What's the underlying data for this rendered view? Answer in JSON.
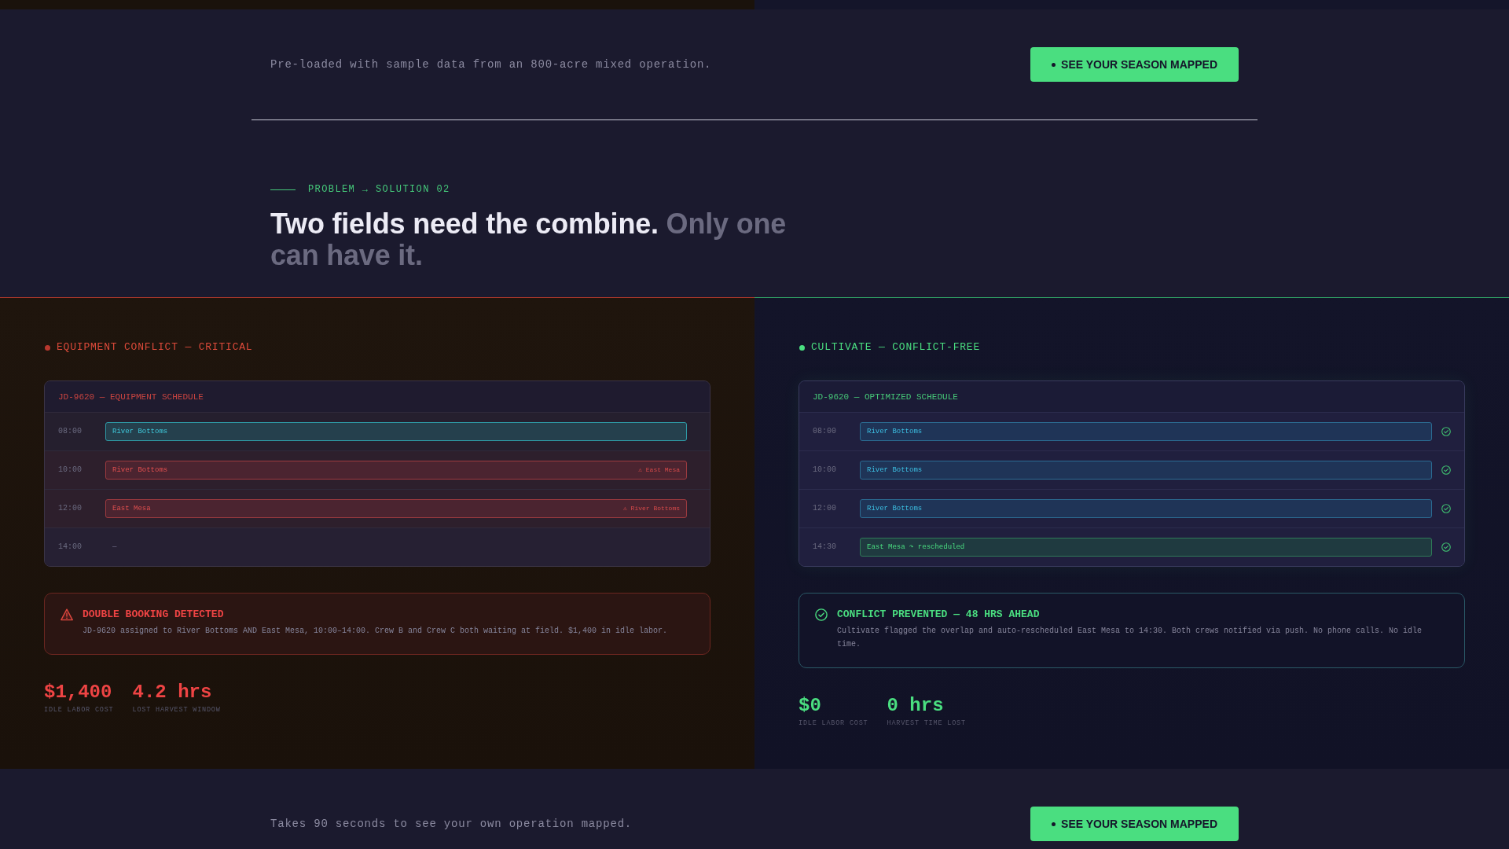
{
  "top_cta": {
    "text": "Pre-loaded with sample data from an 800-acre mixed operation.",
    "button": "SEE YOUR SEASON MAPPED"
  },
  "section": {
    "eyebrow": "PROBLEM → SOLUTION 02",
    "heading": "Two fields need the combine.",
    "heading_muted": "Only one can have it."
  },
  "panels": [
    {
      "kind": "problem",
      "color": "#b8382e",
      "label": "EQUIPMENT CONFLICT — CRITICAL",
      "schedule": {
        "title": "JD-9620 — EQUIPMENT SCHEDULE",
        "rows": [
          {
            "time": "08:00",
            "kind": "booked",
            "field": "River Bottoms",
            "confirmed": false
          },
          {
            "time": "10:00",
            "kind": "conflict",
            "field": "River Bottoms",
            "note": "⚠ East Mesa",
            "confirmed": false
          },
          {
            "time": "12:00",
            "kind": "conflict",
            "field": "East Mesa",
            "note": "⚠ River Bottoms",
            "confirmed": false
          },
          {
            "time": "14:00",
            "kind": "empty",
            "field": "—",
            "confirmed": false
          }
        ]
      },
      "alert": {
        "kind": "warning",
        "title": "DOUBLE BOOKING DETECTED",
        "text": "JD-9620 assigned to River Bottoms AND East Mesa, 10:00–14:00. Crew B and Crew C both waiting at field. $1,400 in idle labor."
      },
      "stats": [
        {
          "value": "$1,400",
          "label": "IDLE LABOR COST"
        },
        {
          "value": "4.2 hrs",
          "label": "LOST HARVEST WINDOW"
        }
      ]
    },
    {
      "kind": "solution",
      "color": "#4ade80",
      "label": "CULTIVATE — CONFLICT-FREE",
      "schedule": {
        "title": "JD-9620 — OPTIMIZED SCHEDULE",
        "rows": [
          {
            "time": "08:00",
            "kind": "booked",
            "field": "River Bottoms",
            "confirmed": true
          },
          {
            "time": "10:00",
            "kind": "booked",
            "field": "River Bottoms",
            "confirmed": true
          },
          {
            "time": "12:00",
            "kind": "booked",
            "field": "River Bottoms",
            "confirmed": true
          },
          {
            "time": "14:30",
            "kind": "rescheduled",
            "field": "East Mesa ↷ rescheduled",
            "confirmed": true
          }
        ]
      },
      "alert": {
        "kind": "success",
        "title": "CONFLICT PREVENTED — 48 HRS AHEAD",
        "text": "Cultivate flagged the overlap and auto-rescheduled East Mesa to 14:30. Both crews notified via push. No phone calls. No idle time."
      },
      "stats": [
        {
          "value": "$0",
          "label": "IDLE LABOR COST"
        },
        {
          "value": "0 hrs",
          "label": "HARVEST TIME LOST"
        }
      ]
    }
  ],
  "bottom_cta": {
    "text": "Takes 90 seconds to see your own operation mapped.",
    "button": "SEE YOUR SEASON MAPPED"
  }
}
